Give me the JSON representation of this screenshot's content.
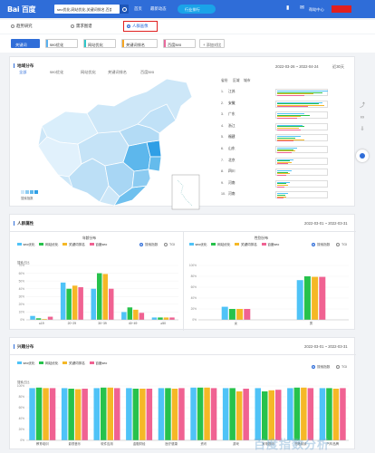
{
  "topbar": {
    "logo": "Bai 百度",
    "search_value": "seo优化,网站优化,关键词排名,百度seo",
    "nav": [
      "首页",
      "最新动态"
    ],
    "pill": "行业排行",
    "help": "帮助中心"
  },
  "tabs": {
    "items": [
      "趋势研究",
      "需求图谱",
      "人群画像"
    ]
  },
  "keywords": {
    "items": [
      {
        "label": "关键词",
        "color": "#2f6dd8",
        "active": true
      },
      {
        "label": "seo优化",
        "color": "#5ab1ef"
      },
      {
        "label": "网站优化",
        "color": "#2ec7c9"
      },
      {
        "label": "关键词排名",
        "color": "#f5a623"
      },
      {
        "label": "百度seo",
        "color": "#e86a9c"
      }
    ],
    "add_label": "+ 添加对比"
  },
  "region": {
    "title": "地域分布",
    "subtabs": [
      "全部",
      "seo优化",
      "网站优化",
      "关键词排名",
      "百度seo"
    ],
    "date_range": "2022-03-26 ~ 2022-04-24",
    "range_select": "近30天",
    "rank_headers": [
      "省份",
      "区域",
      "城市"
    ],
    "legend_label": "搜索指数",
    "ranks": [
      {
        "n": "1.",
        "name": "江苏"
      },
      {
        "n": "2.",
        "name": "安徽"
      },
      {
        "n": "3.",
        "name": "广东"
      },
      {
        "n": "4.",
        "name": "浙江"
      },
      {
        "n": "5.",
        "name": "福建"
      },
      {
        "n": "6.",
        "name": "山东"
      },
      {
        "n": "7.",
        "name": "北京"
      },
      {
        "n": "8.",
        "name": "四川"
      },
      {
        "n": "9.",
        "name": "河南"
      },
      {
        "n": "10.",
        "name": "河南"
      }
    ]
  },
  "crowd": {
    "title": "人群属性",
    "date_range": "2022-03-01 ~ 2022-03-31",
    "age_title": "年龄分布",
    "gender_title": "性别分布",
    "tgi": "TGI",
    "search_index": "搜索指数",
    "ylabel": "搜索占比"
  },
  "interest": {
    "title": "兴趣分布",
    "date_range": "2022-03-01 ~ 2022-03-31",
    "ylabel": "搜索占比",
    "tgi": "TGI",
    "search_index": "搜索指数"
  },
  "series_names": [
    "seo优化",
    "网站优化",
    "关键词排名",
    "百度seo"
  ],
  "series_colors": [
    "#4fc3f7",
    "#27c24c",
    "#f5b826",
    "#f06292"
  ],
  "chart_data": [
    {
      "type": "bar",
      "title": "年龄分布",
      "categories": [
        "≤19",
        "20~29",
        "30~39",
        "40~49",
        "≥50"
      ],
      "ylabel": "搜索占比",
      "ylim": [
        0,
        70
      ],
      "yticks": [
        "0%",
        "10%",
        "20%",
        "30%",
        "40%",
        "50%",
        "60%",
        "70%"
      ],
      "series": [
        {
          "name": "seo优化",
          "values": [
            5,
            48,
            40,
            10,
            3
          ]
        },
        {
          "name": "网站优化",
          "values": [
            2,
            40,
            60,
            16,
            3
          ]
        },
        {
          "name": "关键词排名",
          "values": [
            1,
            44,
            59,
            13,
            3
          ]
        },
        {
          "name": "百度seo",
          "values": [
            4,
            42,
            40,
            9,
            3
          ]
        }
      ]
    },
    {
      "type": "bar",
      "title": "性别分布",
      "categories": [
        "女",
        "男"
      ],
      "ylim": [
        0,
        100
      ],
      "yticks": [
        "0%",
        "20%",
        "40%",
        "60%",
        "80%",
        "100%"
      ],
      "series": [
        {
          "name": "seo优化",
          "values": [
            24,
            73
          ]
        },
        {
          "name": "网站优化",
          "values": [
            20,
            80
          ]
        },
        {
          "name": "关键词排名",
          "values": [
            20,
            79
          ]
        },
        {
          "name": "百度seo",
          "values": [
            20,
            79
          ]
        }
      ]
    },
    {
      "type": "bar",
      "title": "兴趣分布",
      "categories": [
        "教育培训",
        "影视音乐",
        "软件应用",
        "金融财经",
        "医疗健康",
        "资讯",
        "游戏",
        "家电数码",
        "书籍阅读",
        "汽车品牌"
      ],
      "ylim": [
        0,
        100
      ],
      "yticks": [
        "0%",
        "20%",
        "40%",
        "60%",
        "80%",
        "100%"
      ],
      "series": [
        {
          "name": "seo优化",
          "values": [
            96,
            96,
            96,
            96,
            96,
            97,
            96,
            96,
            96,
            96
          ]
        },
        {
          "name": "网站优化",
          "values": [
            97,
            95,
            97,
            95,
            96,
            97,
            96,
            90,
            97,
            96
          ]
        },
        {
          "name": "关键词排名",
          "values": [
            96,
            94,
            97,
            95,
            95,
            97,
            90,
            92,
            97,
            95
          ]
        },
        {
          "name": "百度seo",
          "values": [
            96,
            95,
            96,
            95,
            96,
            96,
            95,
            93,
            96,
            96
          ]
        }
      ]
    }
  ],
  "watermark": "百度指数分析"
}
